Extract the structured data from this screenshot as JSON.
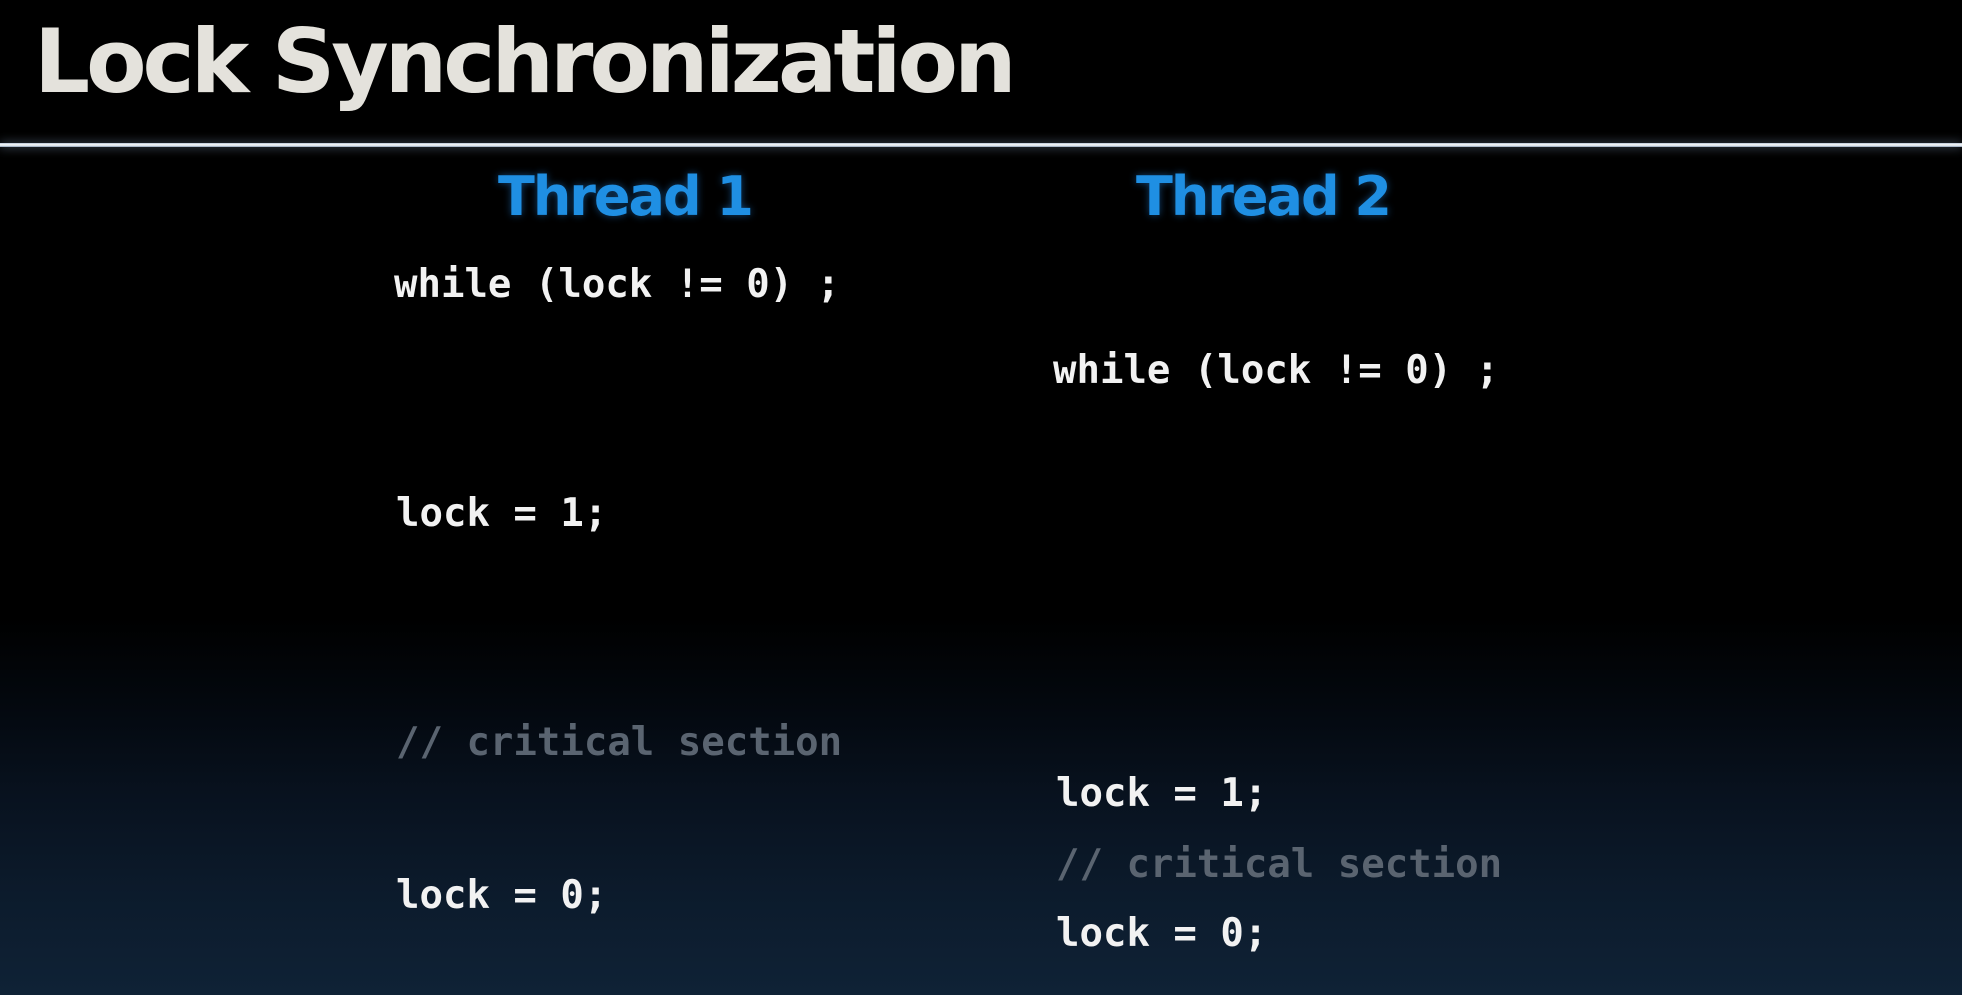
{
  "slide": {
    "title": "Lock Synchronization"
  },
  "thread1": {
    "heading": "Thread 1",
    "lines": {
      "spin": "while (lock != 0) ;",
      "acquire": "lock = 1;",
      "critical": "// critical section",
      "release": "lock = 0;"
    }
  },
  "thread2": {
    "heading": "Thread 2",
    "lines": {
      "spin": "while (lock != 0) ;",
      "acquire": "lock = 1;",
      "critical": "// critical section",
      "release": "lock = 0;"
    }
  },
  "colors": {
    "background": "#000000",
    "title": "#e4e2dc",
    "thread_heading": "#1f8fe3",
    "code": "#f2f2f2",
    "comment": "#5a6470",
    "rule": "#ffffff"
  }
}
